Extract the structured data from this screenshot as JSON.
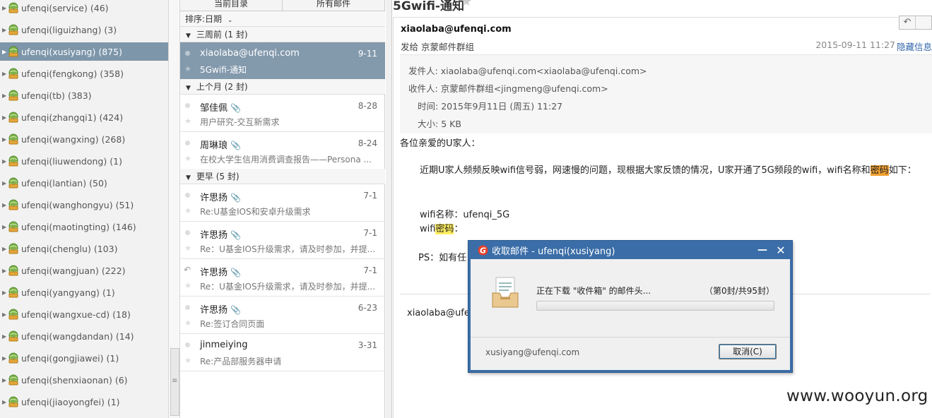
{
  "tree": {
    "accounts": [
      {
        "label": "ufenqi(service)",
        "count": "(46)",
        "selected": false
      },
      {
        "label": "ufenqi(liguizhang)",
        "count": "(3)",
        "selected": false
      },
      {
        "label": "ufenqi(xusiyang)",
        "count": "(875)",
        "selected": true
      },
      {
        "label": "ufenqi(fengkong)",
        "count": "(358)",
        "selected": false
      },
      {
        "label": "ufenqi(tb)",
        "count": "(383)",
        "selected": false
      },
      {
        "label": "ufenqi(zhangqi1)",
        "count": "(424)",
        "selected": false
      },
      {
        "label": "ufenqi(wangxing)",
        "count": "(268)",
        "selected": false
      },
      {
        "label": "ufenqi(liuwendong)",
        "count": "(1)",
        "selected": false
      },
      {
        "label": "ufenqi(lantian)",
        "count": "(50)",
        "selected": false
      },
      {
        "label": "ufenqi(wanghongyu)",
        "count": "(51)",
        "selected": false
      },
      {
        "label": "ufenqi(maotingting)",
        "count": "(146)",
        "selected": false
      },
      {
        "label": "ufenqi(chenglu)",
        "count": "(103)",
        "selected": false
      },
      {
        "label": "ufenqi(wangjuan)",
        "count": "(222)",
        "selected": false
      },
      {
        "label": "ufenqi(yangyang)",
        "count": "(1)",
        "selected": false
      },
      {
        "label": "ufenqi(wangxue-cd)",
        "count": "(18)",
        "selected": false
      },
      {
        "label": "ufenqi(wangdandan)",
        "count": "(14)",
        "selected": false
      },
      {
        "label": "ufenqi(gongjiawei)",
        "count": "(1)",
        "selected": false
      },
      {
        "label": "ufenqi(shenxiaonan)",
        "count": "(6)",
        "selected": false
      },
      {
        "label": "ufenqi(jiaoyongfei)",
        "count": "(1)",
        "selected": false
      }
    ]
  },
  "list": {
    "tabs": [
      "当前目录",
      "所有邮件"
    ],
    "sort_label": "排序:日期",
    "groups": [
      {
        "label": "三周前 (1 封)"
      },
      {
        "label": "上个月 (2 封)"
      },
      {
        "label": "更早 (5 封)"
      }
    ],
    "messages": [
      {
        "from": "xiaolaba@ufenqi.com",
        "date": "9-11",
        "subject": "5Gwifi-通知",
        "attach": false,
        "replied": false,
        "selected": true
      },
      {
        "from": "邹佳佩",
        "date": "8-28",
        "subject": "用户研究-交互新需求",
        "attach": true,
        "replied": false,
        "selected": false
      },
      {
        "from": "周琳琅",
        "date": "8-24",
        "subject": "在校大学生信用消费调查报告——Persona ...",
        "attach": true,
        "replied": false,
        "selected": false
      },
      {
        "from": "许思扬",
        "date": "7-1",
        "subject": "Re:U基金IOS和安卓升级需求",
        "attach": true,
        "replied": false,
        "selected": false
      },
      {
        "from": "许思扬",
        "date": "7-1",
        "subject": "Re：U基金IOS升级需求，请及时参加，并提...",
        "attach": true,
        "replied": false,
        "selected": false
      },
      {
        "from": "许思扬",
        "date": "7-1",
        "subject": "Re：U基金IOS升级需求，请及时参加，并提...",
        "attach": true,
        "replied": true,
        "selected": false
      },
      {
        "from": "许思扬",
        "date": "6-23",
        "subject": "Re:签订合同页面",
        "attach": true,
        "replied": false,
        "selected": false
      },
      {
        "from": "jinmeiying",
        "date": "3-31",
        "subject": "Re:产品部服务器申请",
        "attach": false,
        "replied": false,
        "selected": false
      }
    ]
  },
  "reader": {
    "title": "5Gwifi-通知",
    "from_bold": "xiaolaba@ufenqi.com",
    "to_line": "发给 京蒙邮件群组",
    "date_short": "2015-09-11 11:27",
    "hide_link": "隐藏信息",
    "meta": {
      "sender_key": "发件人:",
      "sender_val": "xiaolaba@ufenqi.com<xiaolaba@ufenqi.com>",
      "recipient_key": "收件人:",
      "recipient_val": "京蒙邮件群组<jingmeng@ufenqi.com>",
      "time_key": "时间:",
      "time_val": "2015年9月11日 (周五) 11:27",
      "size_key": "大小:",
      "size_val": "5 KB"
    },
    "body": {
      "greeting": "各位亲爱的U家人：",
      "para_a": "近期U家人频频反映wifi信号弱，网速慢的问题，现根据大家反馈的情况，U家开通了5G频段的wifi，wifi名称和",
      "para_hl": "密码",
      "para_b": "如下：",
      "wifi_name": "wifi名称：ufenqi_5G",
      "wifi_pw_a": "wifi",
      "wifi_pw_hl": "密码",
      "wifi_pw_b": "：",
      "ps": "PS：如有任",
      "sig_from": "xiaolaba@ufe"
    }
  },
  "dialog": {
    "title": "收取邮件 - ufenqi(xusiyang)",
    "message": "正在下载 \"收件箱\" 的邮件头...",
    "progress_text": "（第0封/共95封）",
    "progress_fraction": 0,
    "user": "xusiyang@ufenqi.com",
    "cancel_label": "取消(C)"
  },
  "watermark": "www.wooyun.org"
}
